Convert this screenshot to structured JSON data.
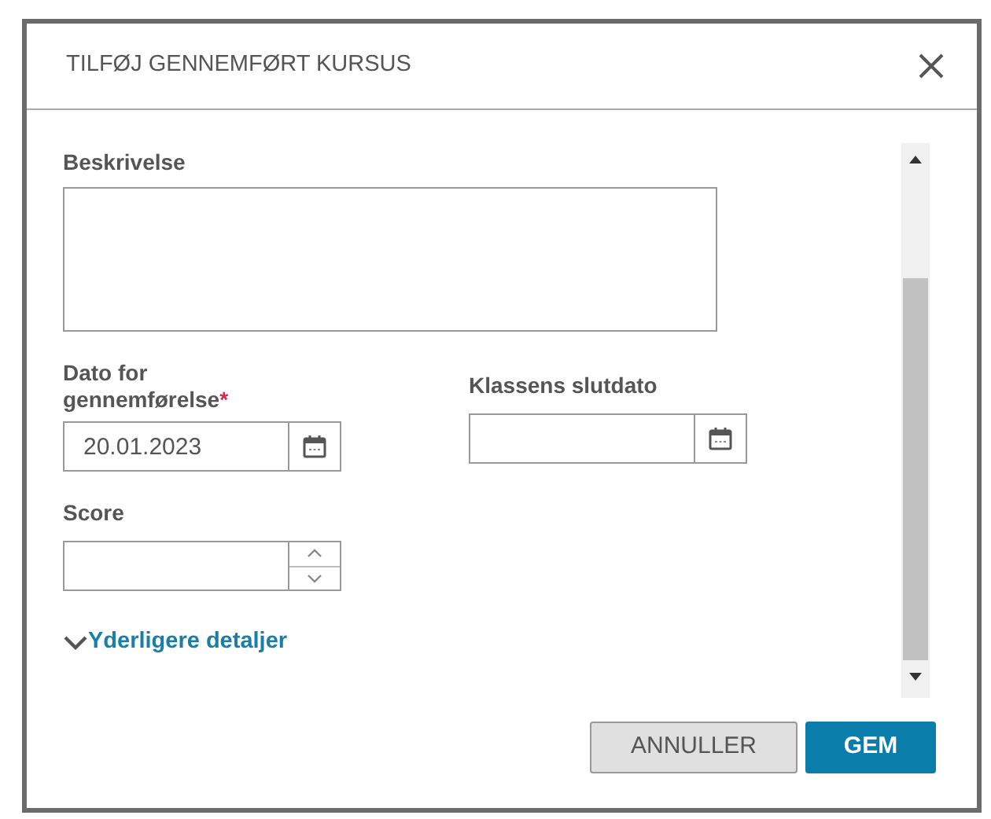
{
  "dialog": {
    "title": "TILFØJ GENNEMFØRT KURSUS"
  },
  "description": {
    "label": "Beskrivelse"
  },
  "completion_date": {
    "label": "Dato for gennemførelse",
    "required": true,
    "required_mark": "*",
    "value": "20.01.2023"
  },
  "class_end_date": {
    "label": "Klassens slutdato"
  },
  "score": {
    "label": "Score"
  },
  "more_details": {
    "label": "Yderligere detaljer",
    "expanded": false
  },
  "buttons": [
    {
      "label": "ANNULLER",
      "kind": "secondary"
    },
    {
      "label": "GEM",
      "kind": "primary"
    }
  ]
}
